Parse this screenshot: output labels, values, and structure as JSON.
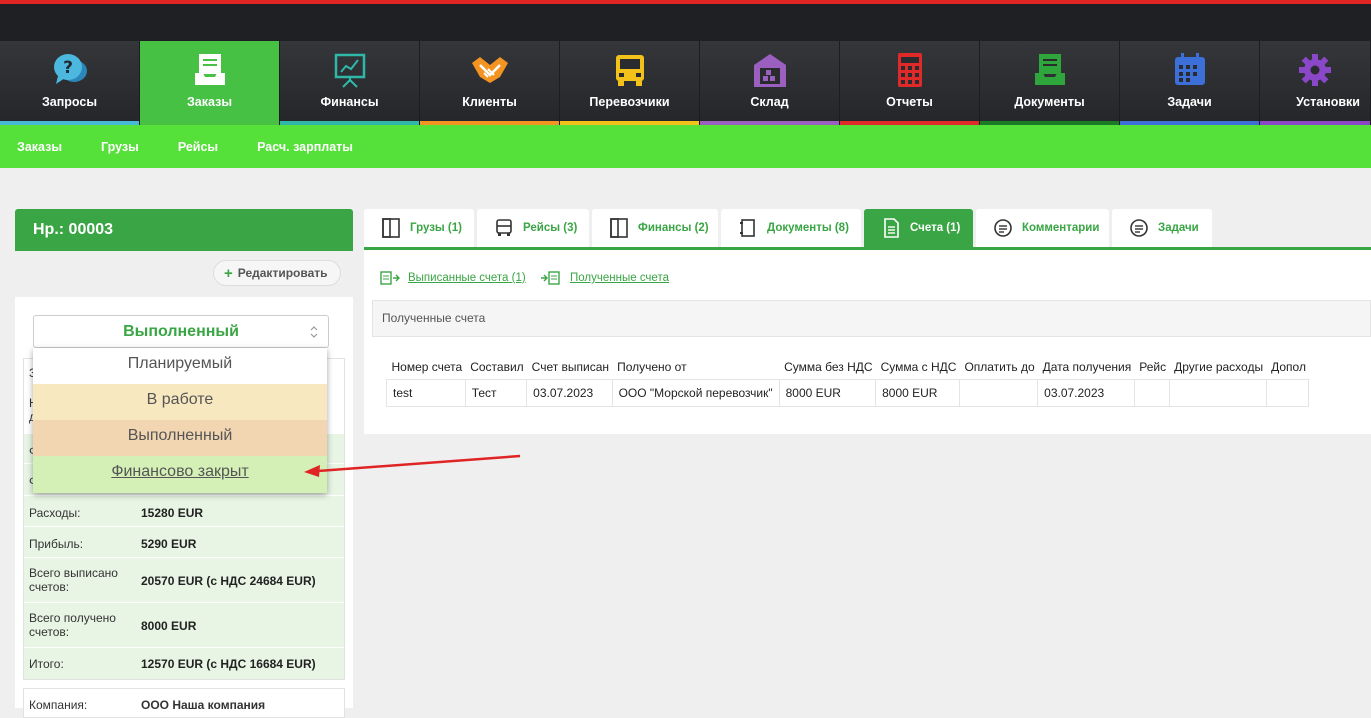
{
  "top_nav": [
    {
      "label": "Запросы",
      "icon": "question-bubble-icon",
      "stripe": "#46b9d6"
    },
    {
      "label": "Заказы",
      "icon": "inbox-tray-icon",
      "stripe": "#46c144",
      "active": true
    },
    {
      "label": "Финансы",
      "icon": "presentation-chart-icon",
      "stripe": "#2fb8a8"
    },
    {
      "label": "Клиенты",
      "icon": "handshake-icon",
      "stripe": "#f39322"
    },
    {
      "label": "Перевозчики",
      "icon": "truck-icon",
      "stripe": "#f2c21b"
    },
    {
      "label": "Склад",
      "icon": "warehouse-icon",
      "stripe": "#9b5fc0"
    },
    {
      "label": "Отчеты",
      "icon": "calculator-icon",
      "stripe": "#e02a2a"
    },
    {
      "label": "Документы",
      "icon": "document-tray-icon",
      "stripe": "#2fa63c"
    },
    {
      "label": "Задачи",
      "icon": "calendar-icon",
      "stripe": "#3d6fd8"
    },
    {
      "label": "Установки",
      "icon": "gear-icon",
      "stripe": "#8a47c7"
    }
  ],
  "sub_nav": [
    "Заказы",
    "Грузы",
    "Рейсы",
    "Расч. зарплаты"
  ],
  "left_panel": {
    "title": "Нр.: 00003",
    "edit_label": "Редактировать",
    "status_value": "Выполненный",
    "status_options": [
      {
        "label": "Планируемый",
        "bg": "#ffffff"
      },
      {
        "label": "В работе",
        "bg": "#f7e8bf"
      },
      {
        "label": "Выполненный",
        "bg": "#f2d6b2"
      },
      {
        "label": "Финансово закрыт",
        "bg": "#d4f0b6"
      }
    ],
    "info_rows": [
      {
        "key": "З",
        "value": ""
      },
      {
        "key": "Н\nд",
        "value": ""
      },
      {
        "key": "Ф",
        "value": ""
      },
      {
        "key": "Ф",
        "value": ""
      },
      {
        "key": "Расходы:",
        "value": "15280 EUR"
      },
      {
        "key": "Прибыль:",
        "value": "5290 EUR"
      },
      {
        "key": "Всего выписано\nсчетов:",
        "value": "20570 EUR (с НДС 24684 EUR)"
      },
      {
        "key": "Всего получено\nсчетов:",
        "value": "8000 EUR"
      },
      {
        "key": "Итого:",
        "value": "12570 EUR (с НДС 16684 EUR)"
      }
    ],
    "company_key": "Компания:",
    "company_value": "ООО Наша компания"
  },
  "tabs": [
    {
      "label": "Грузы (1)",
      "icon": "panel-icon"
    },
    {
      "label": "Рейсы (3)",
      "icon": "truck-front-icon"
    },
    {
      "label": "Финансы (2)",
      "icon": "panel-icon"
    },
    {
      "label": "Документы (8)",
      "icon": "document-icon"
    },
    {
      "label": "Счета (1)",
      "icon": "invoice-icon",
      "active": true
    },
    {
      "label": "Комментарии",
      "icon": "chat-icon"
    },
    {
      "label": "Задачи",
      "icon": "chat-icon"
    }
  ],
  "sub_links": [
    "Выписанные счета (1)",
    "Полученные счета"
  ],
  "section_title": "Полученные счета",
  "table": {
    "headers": [
      "Номер счета",
      "Составил",
      "Счет выписан",
      "Получено от",
      "Сумма без НДС",
      "Сумма с НДС",
      "Оплатить до",
      "Дата получения",
      "Рейс",
      "Другие расходы",
      "Допол"
    ],
    "rows": [
      [
        "test",
        "Тест",
        "03.07.2023",
        "ООО \"Морской перевозчик\"",
        "8000 EUR",
        "8000 EUR",
        "",
        "03.07.2023",
        "",
        "",
        ""
      ]
    ]
  }
}
